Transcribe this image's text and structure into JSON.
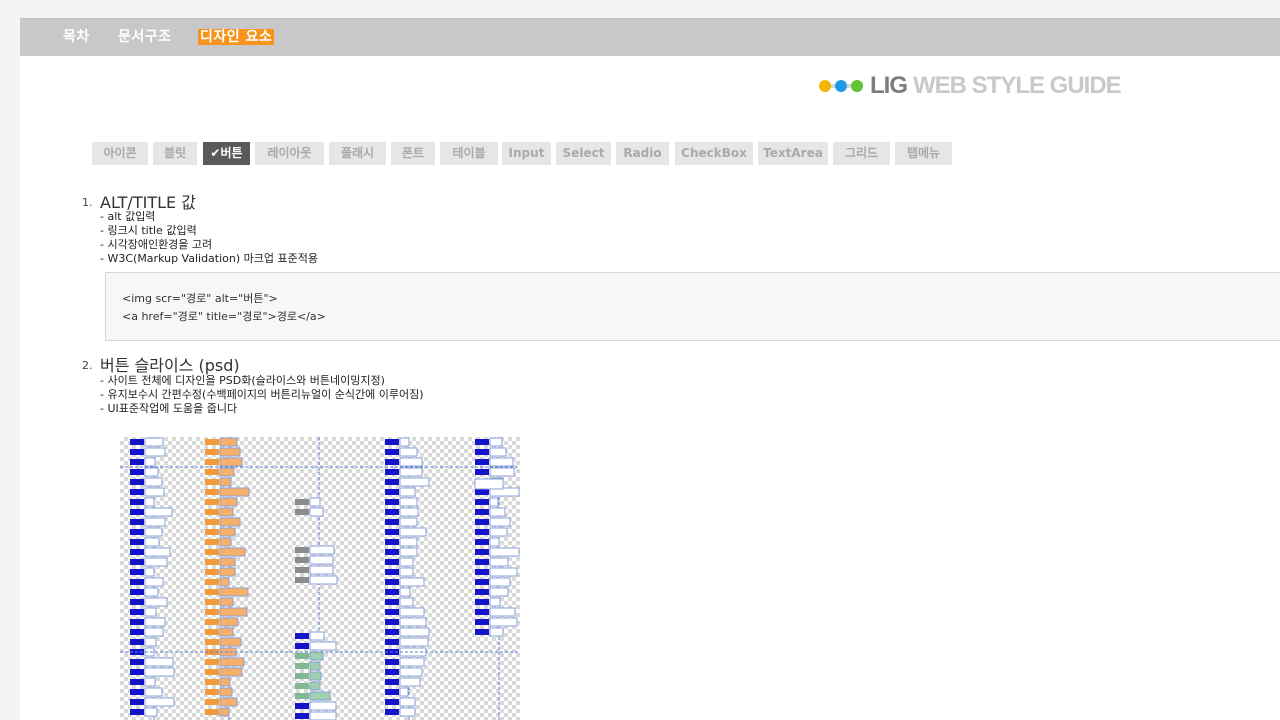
{
  "nav": {
    "items": [
      {
        "label": "목차",
        "active": false
      },
      {
        "label": "문서구조",
        "active": false
      },
      {
        "label": "디자인 요소",
        "active": true
      }
    ]
  },
  "logo": {
    "brand": "LIG",
    "text": "WEB STYLE GUIDE"
  },
  "tabs": [
    {
      "label": "아이콘",
      "active": false
    },
    {
      "label": "블릿",
      "active": false
    },
    {
      "label": "✔버튼",
      "active": true
    },
    {
      "label": "레이아웃",
      "active": false
    },
    {
      "label": "플래시",
      "active": false
    },
    {
      "label": "폰트",
      "active": false
    },
    {
      "label": "테이블",
      "active": false
    },
    {
      "label": "Input",
      "active": false
    },
    {
      "label": "Select",
      "active": false
    },
    {
      "label": "Radio",
      "active": false
    },
    {
      "label": "CheckBox",
      "active": false
    },
    {
      "label": "TextArea",
      "active": false
    },
    {
      "label": "그리드",
      "active": false
    },
    {
      "label": "탭메뉴",
      "active": false
    }
  ],
  "sections": [
    {
      "number": "1.",
      "title": "ALT/TITLE 값",
      "bullets": [
        "- alt 값입력",
        "- 링크시 title 값입력",
        "- 시각장애인환경을 고려",
        "- W3C(Markup Validation) 마크업 표준적용"
      ]
    },
    {
      "number": "2.",
      "title": "버튼 슬라이스 (psd)",
      "bullets": [
        "- 사이트 전체에 디자인을 PSD화(슬라이스와 버튼네이밍지정)",
        "- 유지보수시 간편수정(수백페이지의 버튼리뉴얼이 순식간에 이루어짐)",
        "- UI표준작업에 도움을 줍니다"
      ]
    }
  ],
  "code": {
    "line1": "<img scr=\"경로\" alt=\"버튼\">",
    "line2": "<a href=\"경로\" title=\"경로\">경로</a>"
  }
}
